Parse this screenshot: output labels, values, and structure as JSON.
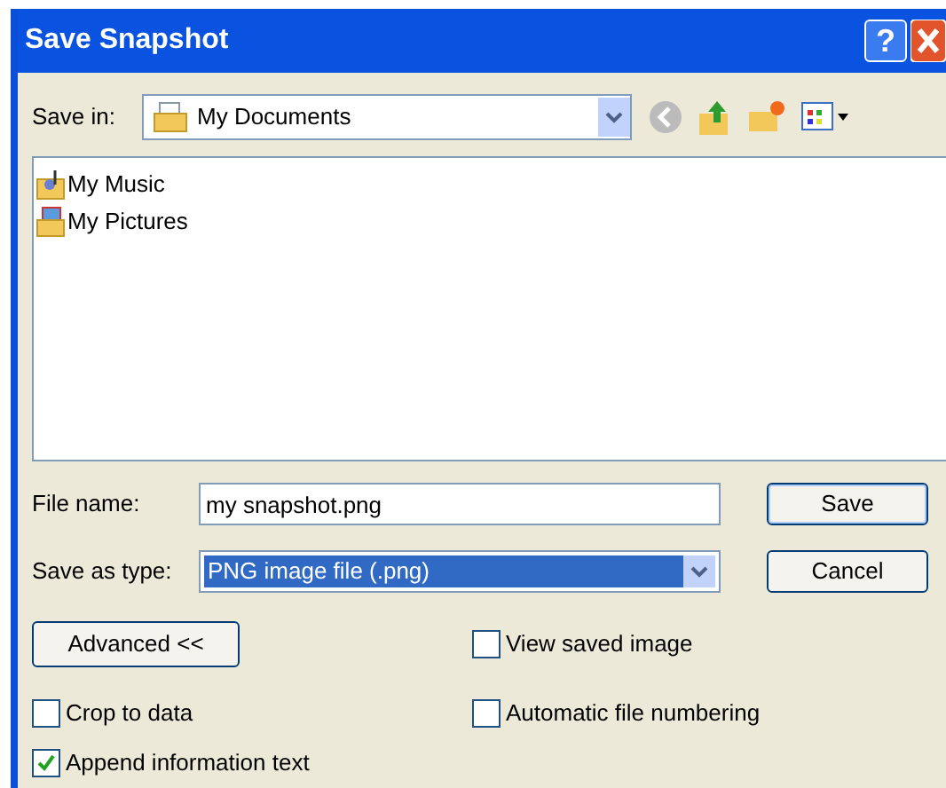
{
  "window": {
    "title": "Save Snapshot",
    "help": "?"
  },
  "save_in": {
    "label": "Save in:",
    "value": "My Documents"
  },
  "files": [
    {
      "name": "My Music",
      "kind": "music"
    },
    {
      "name": "My Pictures",
      "kind": "pictures"
    }
  ],
  "file_name": {
    "label": "File name:",
    "value": "my snapshot.png"
  },
  "save_as_type": {
    "label": "Save as type:",
    "value": "PNG image file (.png)",
    "focused": true
  },
  "buttons": {
    "save": "Save",
    "cancel": "Cancel",
    "advanced": "Advanced <<"
  },
  "options": [
    {
      "label": "View saved image",
      "checked": false
    },
    {
      "label": "Crop to data",
      "checked": false
    },
    {
      "label": "Automatic file numbering",
      "checked": false
    },
    {
      "label": "Append information text",
      "checked": true
    }
  ]
}
